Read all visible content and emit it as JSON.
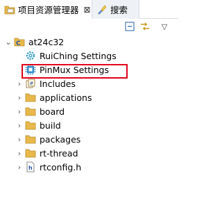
{
  "tabs": [
    {
      "label": "项目资源管理器",
      "close": "⊠",
      "icon": "project-explorer-icon"
    },
    {
      "label": "搜索",
      "icon": "search-icon"
    }
  ],
  "toolbar": {
    "buttons": [
      "collapse-all-icon",
      "link-with-editor-icon",
      "view-menu-icon"
    ],
    "menu_glyph": "▽"
  },
  "tree": {
    "root": {
      "label": "at24c32",
      "icon": "c-project-icon",
      "expanded": true
    },
    "items": [
      {
        "label": "RuiChing Settings",
        "icon": "settings-gear-icon",
        "twisty": ""
      },
      {
        "label": "PinMux Settings",
        "icon": "chip-icon",
        "twisty": "",
        "highlighted": true
      },
      {
        "label": "Includes",
        "icon": "includes-icon",
        "twisty": "›"
      },
      {
        "label": "applications",
        "icon": "folder-icon",
        "twisty": "›"
      },
      {
        "label": "board",
        "icon": "folder-icon",
        "twisty": "›"
      },
      {
        "label": "build",
        "icon": "folder-icon",
        "twisty": "›"
      },
      {
        "label": "packages",
        "icon": "folder-icon",
        "twisty": "›"
      },
      {
        "label": "rt-thread",
        "icon": "folder-icon",
        "twisty": "›"
      },
      {
        "label": "rtconfig.h",
        "icon": "header-file-icon",
        "twisty": "›"
      }
    ]
  },
  "colors": {
    "highlight_border": "#e0001b",
    "folder": "#e8b84a",
    "tab_border": "#d6dde6"
  }
}
